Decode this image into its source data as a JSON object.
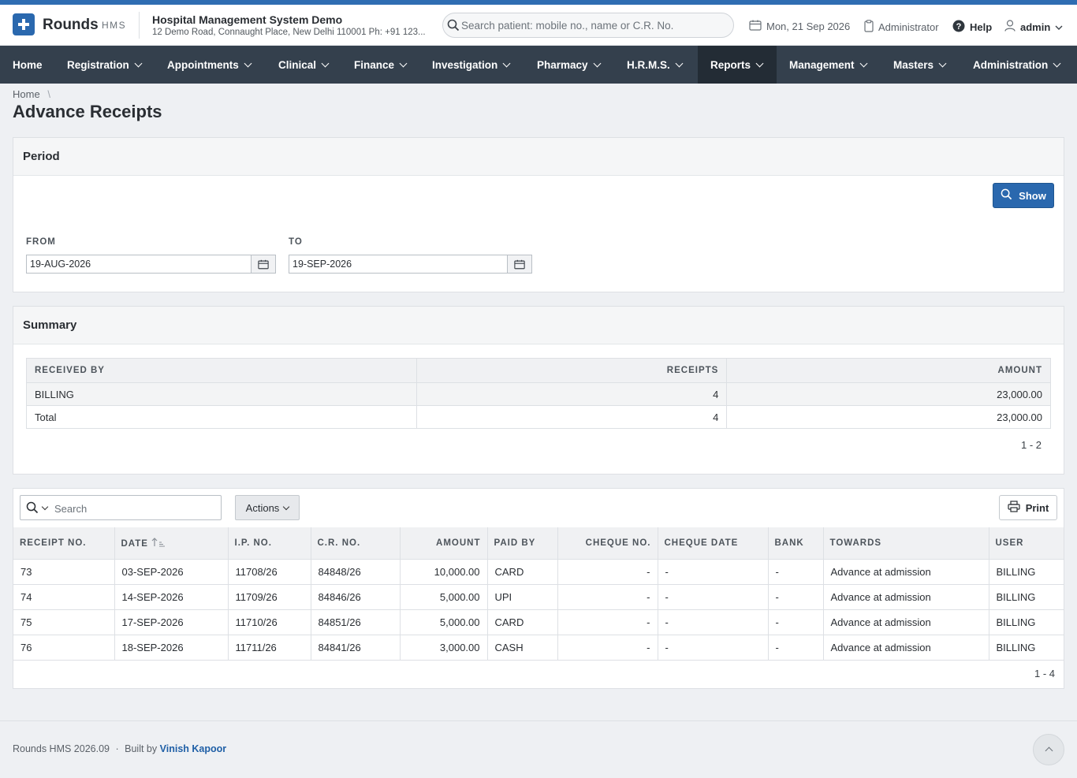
{
  "header": {
    "brand": "Rounds",
    "brand_sub": "HMS",
    "org_name": "Hospital Management System Demo",
    "org_address": "12 Demo Road, Connaught Place, New Delhi 110001 Ph: +91 123...",
    "search_placeholder": "Search patient: mobile no., name or C.R. No.",
    "date": "Mon, 21 Sep 2026",
    "role": "Administrator",
    "help": "Help",
    "user": "admin"
  },
  "nav": {
    "items": [
      "Home",
      "Registration",
      "Appointments",
      "Clinical",
      "Finance",
      "Investigation",
      "Pharmacy",
      "H.R.M.S.",
      "Reports",
      "Management",
      "Masters",
      "Administration"
    ],
    "active": "Reports"
  },
  "breadcrumb": {
    "home": "Home",
    "sep": "\\"
  },
  "page_title": "Advance Receipts",
  "period": {
    "title": "Period",
    "show_label": "Show",
    "from_label": "FROM",
    "from_value": "19-AUG-2026",
    "to_label": "TO",
    "to_value": "19-SEP-2026"
  },
  "summary": {
    "title": "Summary",
    "columns": [
      "RECEIVED BY",
      "RECEIPTS",
      "AMOUNT"
    ],
    "rows": [
      [
        "BILLING",
        "4",
        "23,000.00"
      ],
      [
        "Total",
        "4",
        "23,000.00"
      ]
    ],
    "pagination": "1 - 2"
  },
  "receipts": {
    "search_placeholder": "Search",
    "actions_label": "Actions",
    "print_label": "Print",
    "columns": [
      "RECEIPT NO.",
      "DATE",
      "I.P. NO.",
      "C.R. NO.",
      "AMOUNT",
      "PAID BY",
      "CHEQUE NO.",
      "CHEQUE DATE",
      "BANK",
      "TOWARDS",
      "USER"
    ],
    "rows": [
      [
        "73",
        "03-SEP-2026",
        "11708/26",
        "84848/26",
        "10,000.00",
        "CARD",
        "-",
        "-",
        "-",
        "Advance at admission",
        "BILLING"
      ],
      [
        "74",
        "14-SEP-2026",
        "11709/26",
        "84846/26",
        "5,000.00",
        "UPI",
        "-",
        "-",
        "-",
        "Advance at admission",
        "BILLING"
      ],
      [
        "75",
        "17-SEP-2026",
        "11710/26",
        "84851/26",
        "5,000.00",
        "CARD",
        "-",
        "-",
        "-",
        "Advance at admission",
        "BILLING"
      ],
      [
        "76",
        "18-SEP-2026",
        "11711/26",
        "84841/26",
        "3,000.00",
        "CASH",
        "-",
        "-",
        "-",
        "Advance at admission",
        "BILLING"
      ]
    ],
    "pagination": "1 - 4"
  },
  "footer": {
    "version": "Rounds HMS 2026.09",
    "dot": "·",
    "built_by": "Built by",
    "author": "Vinish Kapoor"
  },
  "colors": {
    "accent": "#2a68ae",
    "navbar": "#34404d",
    "nav_active": "#232c35"
  }
}
